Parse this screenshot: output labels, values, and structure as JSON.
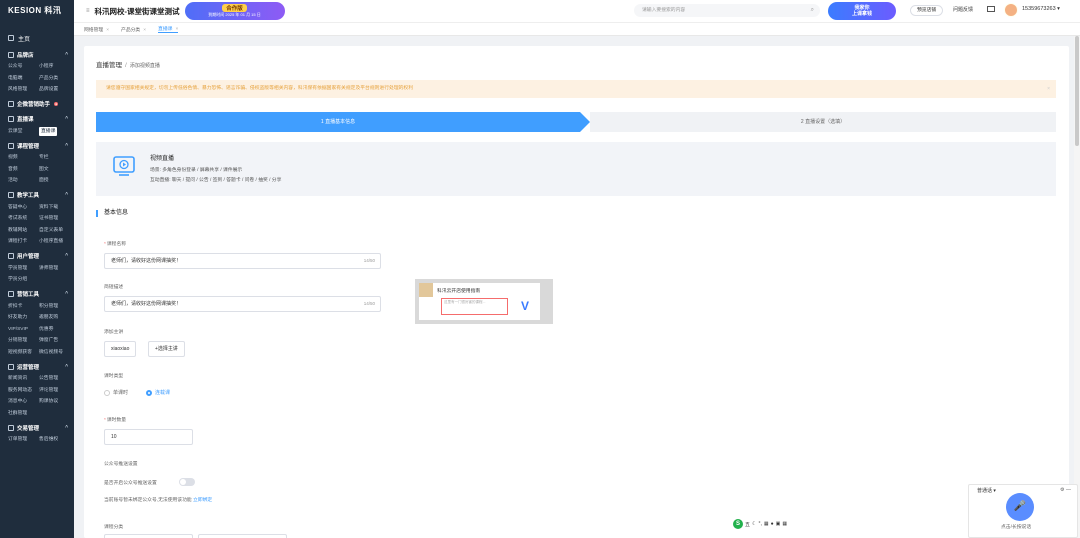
{
  "app": {
    "logo": "KESION 科汛",
    "site_title": "科汛网校-课堂街课堂测试",
    "promo_title": "合作版",
    "promo_sub": "到期时间 2025 年 01 月 15 日"
  },
  "header": {
    "search_placeholder": "请输入要搜索的内容",
    "ad_text_line1": "我家你",
    "ad_text_line2": "上课拿钱",
    "verify_label": "预览店铺",
    "feedback_label": "问题反馈",
    "user": "15359673263"
  },
  "tabs": [
    {
      "label": "网络管理"
    },
    {
      "label": "产品分类"
    },
    {
      "label": "直播课"
    }
  ],
  "sidebar": {
    "home": "主页",
    "groups": [
      {
        "title": "品牌店",
        "items": [
          "公众号",
          "小程序",
          "电脑端",
          "产品分类",
          "风格管理",
          "品牌设置"
        ]
      },
      {
        "title": "企微营销助手",
        "items": []
      },
      {
        "title": "直播课",
        "items": [
          "云课堂",
          "直播课"
        ]
      },
      {
        "title": "课程管理",
        "items": [
          "视频",
          "专栏",
          "音频",
          "图文",
          "活动",
          "面授"
        ]
      },
      {
        "title": "教学工具",
        "items": [
          "答疑中心",
          "资料下载",
          "考试系统",
          "证书管理",
          "教辅网站",
          "自定义表单",
          "课程打卡",
          "小程序直播"
        ]
      },
      {
        "title": "用户管理",
        "items": [
          "学员管理",
          "讲师管理",
          "学员分组"
        ]
      },
      {
        "title": "营销工具",
        "items": [
          "折扣卡",
          "积分管理",
          "好友助力",
          "邀朋友购",
          "VIP/SVIP",
          "优惠券",
          "分销管理",
          "弹窗广告",
          "短视频获客",
          "微信视频号"
        ]
      },
      {
        "title": "运营管理",
        "items": [
          "新闻资讯",
          "公告管理",
          "服务网动态",
          "评论管理",
          "消息中心",
          "购课协议",
          "社群管理"
        ]
      },
      {
        "title": "交易管理",
        "items": [
          "订单管理",
          "售后维权"
        ]
      }
    ]
  },
  "main": {
    "breadcrumb_title": "直播管理",
    "breadcrumb_sub": "添加视频直播",
    "notice": "请您遵守国家相关规定，切勿上传低俗色情、暴力恐怖、谣言诈骗、侵权盗版等相关内容，科汛保有依据国家有关规定及平台规则进行处理的权利",
    "step1": "1 直播基本信息",
    "step2": "2 直播设置（选填）",
    "live_type": "视频直播",
    "live_scene": "场景: 多角色身份登录 / 屏幕共享 / 课件展示",
    "live_interaction": "互动直播: 聊天 / 提问 / 公告 / 签到 / 答题卡 / 问卷 / 抽奖 / 分享",
    "section_title": "基本信息",
    "course_name_label": "课程名称",
    "course_name_value": "老师们，请收好这份网课抽奖！",
    "course_name_count": "14/50",
    "course_intro_label": "简短描述",
    "course_intro_value": "老师们，请收好这份网课抽奖！",
    "course_intro_count": "14/50",
    "lecturer_label": "添加主讲",
    "lecturer_value": "xiaoxiao",
    "add_lecturer": "+选择主讲",
    "class_type_label": "课时类型",
    "class_type_single": "单课时",
    "class_type_multi": "连载课",
    "class_count_label": "课时数量",
    "class_count_value": "10",
    "wechat_label": "公众号推送设置",
    "wechat_switch_label": "是否开启公众号推送设置",
    "wechat_hint": "当前账号暂未绑定公众号,无法使用该功能",
    "wechat_link": "立即绑定",
    "category_label": "课程分类",
    "preview_title": "科汛云开店使用指南",
    "preview_hint": "这里有一门很厉害的课程..."
  },
  "voice": {
    "label": "普通话",
    "hint": "点击/长按说话"
  },
  "ime": {
    "mode": "五"
  },
  "colors": {
    "sidebar_bg": "#1f2d3d",
    "accent": "#409eff",
    "notice_text": "#e6a23c",
    "required": "#f56c6c"
  }
}
